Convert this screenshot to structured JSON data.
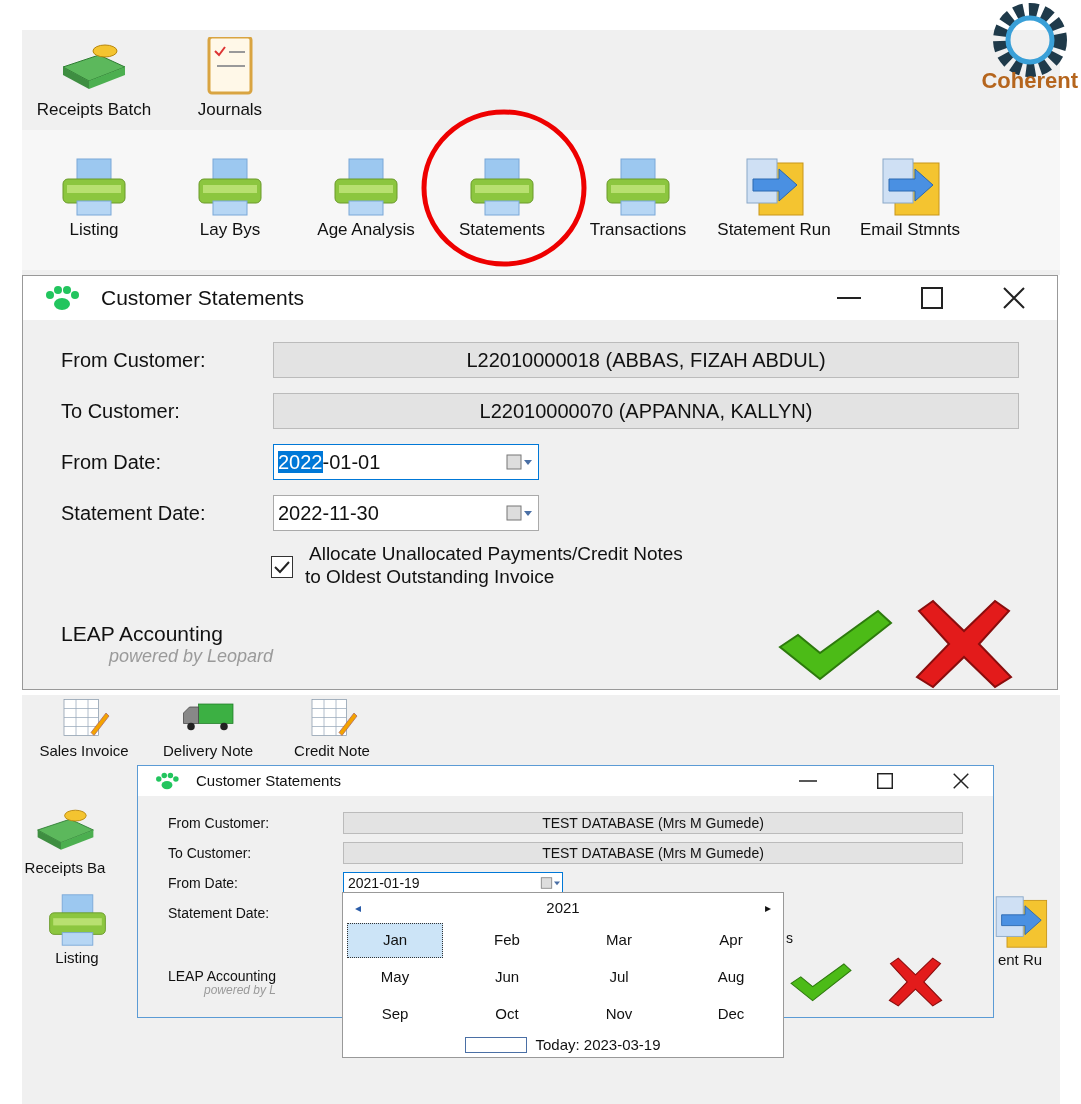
{
  "top_toolbar": {
    "rows": [
      [
        {
          "label": "Receipts Batch",
          "kind": "money"
        },
        {
          "label": "Journals",
          "kind": "checklist"
        }
      ],
      [
        {
          "label": "Listing",
          "kind": "printer"
        },
        {
          "label": "Lay Bys",
          "kind": "printer"
        },
        {
          "label": "Age Analysis",
          "kind": "printer"
        },
        {
          "label": "Statements",
          "kind": "printer"
        },
        {
          "label": "Transactions",
          "kind": "printer"
        },
        {
          "label": "Statement Run",
          "kind": "folder"
        },
        {
          "label": "Email Stmnts",
          "kind": "folder"
        }
      ]
    ]
  },
  "logo": {
    "text": "Coherent"
  },
  "dialog": {
    "title": "Customer Statements",
    "fields": [
      {
        "label": "From Customer:",
        "kind": "customer",
        "value": "L22010000018 (ABBAS, FIZAH ABDUL)"
      },
      {
        "label": "To Customer:",
        "kind": "customer",
        "value": "L22010000070 (APPANNA, KALLYN)"
      },
      {
        "label": "From Date:",
        "kind": "date",
        "selected_text": "2022",
        "value": "-01-01",
        "focused": true
      },
      {
        "label": "Statement Date:",
        "kind": "date",
        "value": "2022-11-30",
        "focused": false
      }
    ],
    "checkbox": {
      "lines": [
        "Allocate Unallocated Payments/Credit Notes",
        "to Oldest Outstanding Invoice"
      ],
      "checked": true
    },
    "brand": {
      "name": "LEAP Accounting",
      "tagline": "powered by Leopard"
    }
  },
  "second_screen": {
    "toolbar_rows": [
      [
        {
          "label": "Sales Invoice",
          "kind": "invoice"
        },
        {
          "label": "Delivery Note",
          "kind": "truck"
        },
        {
          "label": "Credit Note",
          "kind": "invoice"
        }
      ],
      [
        {
          "label": "Receipts Ba",
          "kind": "money"
        }
      ],
      [
        {
          "label": "Listing",
          "kind": "printer"
        }
      ]
    ],
    "right_item": {
      "label": "ent Ru",
      "kind": "folder"
    },
    "dialog": {
      "title": "Customer Statements",
      "fields": [
        {
          "label": "From Customer:",
          "kind": "customer",
          "value": "TEST DATABASE (Mrs M Gumede)"
        },
        {
          "label": "To Customer:",
          "kind": "customer",
          "value": "TEST DATABASE (Mrs M Gumede)"
        },
        {
          "label": "From Date:",
          "kind": "date",
          "value": "2021-01-19",
          "focused": true
        },
        {
          "label": "Statement Date:",
          "kind": "hidden"
        }
      ],
      "checkbox_fragment": "s",
      "brand": {
        "name": "LEAP Accounting",
        "tagline": "powered by L"
      }
    },
    "calendar": {
      "year": "2021",
      "prev": "◂",
      "next": "▸",
      "months": [
        {
          "label": "Jan",
          "selected": true
        },
        {
          "label": "Feb",
          "selected": false
        },
        {
          "label": "Mar",
          "selected": false
        },
        {
          "label": "Apr",
          "selected": false
        },
        {
          "label": "May",
          "selected": false
        },
        {
          "label": "Jun",
          "selected": false
        },
        {
          "label": "Jul",
          "selected": false
        },
        {
          "label": "Aug",
          "selected": false
        },
        {
          "label": "Sep",
          "selected": false
        },
        {
          "label": "Oct",
          "selected": false
        },
        {
          "label": "Nov",
          "selected": false
        },
        {
          "label": "Dec",
          "selected": false
        }
      ],
      "today": "Today: 2023-03-19"
    }
  }
}
